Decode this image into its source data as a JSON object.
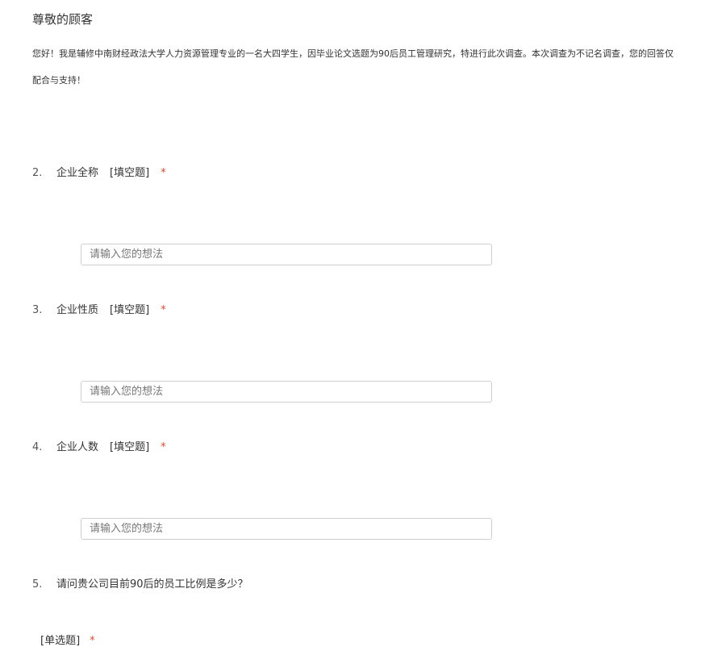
{
  "survey": {
    "title": "尊敬的顾客",
    "intro_line_1": "您好！我是辅修中南财经政法大学人力资源管理专业的一名大四学生，因毕业论文选题为90后员工管理研究，特进行此次调查。本次调查为不记名调查，您的回答仅",
    "intro_line_2": "配合与支持！"
  },
  "questions": [
    {
      "number": "2.",
      "text": "企业全称",
      "type": "[填空题]",
      "required_mark": "*",
      "placeholder": "请输入您的想法"
    },
    {
      "number": "3.",
      "text": "企业性质",
      "type": "[填空题]",
      "required_mark": "*",
      "placeholder": "请输入您的想法"
    },
    {
      "number": "4.",
      "text": "企业人数",
      "type": "[填空题]",
      "required_mark": "*",
      "placeholder": "请输入您的想法"
    },
    {
      "number": "5.",
      "text": "请问贵公司目前90后的员工比例是多少？",
      "type": "[单选题]",
      "required_mark": "*"
    }
  ],
  "colors": {
    "required": "#e8472c",
    "text": "#333333",
    "input_border": "#cfcfcf"
  }
}
